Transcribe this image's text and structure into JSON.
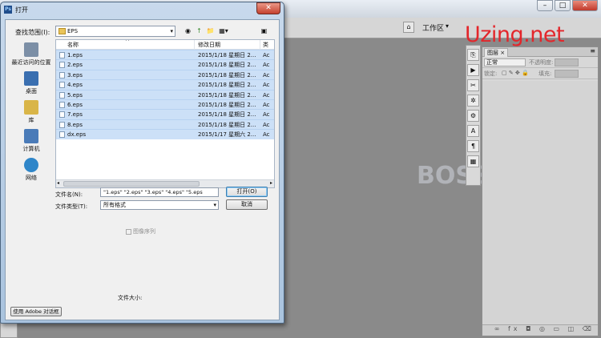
{
  "window_controls": {
    "minimize": "–",
    "maximize": "□",
    "close": "✕"
  },
  "options_bar": {
    "workspace_label": "工作区",
    "workspace_arrow": "▾"
  },
  "logo_text": "Uzing.net",
  "watermark_text": "BOSS 资源",
  "layers_panel": {
    "tab_label": "图层 ×",
    "menu_icon": "≡",
    "blend_mode": "正常",
    "opacity_label": "不透明度:",
    "lock_label": "锁定:",
    "fill_label": "填充:",
    "footer_icons": "∞ fx ◘ ◎ ▭ ◫ ⌫"
  },
  "tool_icons": [
    "⎘",
    "▶",
    "✂",
    "✲",
    "⚙",
    "A",
    "¶",
    "▦"
  ],
  "dialog": {
    "title": "打开",
    "close_label": "✕",
    "lookin_label": "查找范围(I):",
    "lookin_value": "EPS",
    "nav_icons": [
      "◉",
      "↑",
      "📁",
      "▦▾"
    ],
    "extra_icon": "▣",
    "places": [
      {
        "label": "最近访问的位置",
        "color": "#7c8fa6"
      },
      {
        "label": "桌面",
        "color": "#3a6fb0"
      },
      {
        "label": "库",
        "color": "#d9b548"
      },
      {
        "label": "计算机",
        "color": "#4a7bb8"
      },
      {
        "label": "网络",
        "color": "#2f86c9"
      }
    ],
    "columns": {
      "name": "名称",
      "date": "修改日期",
      "type": "类"
    },
    "sort_arrow": "^",
    "files": [
      {
        "name": "1.eps",
        "date": "2015/1/18 星期日 2...",
        "type": "Ac",
        "selected": true
      },
      {
        "name": "2.eps",
        "date": "2015/1/18 星期日 2...",
        "type": "Ac",
        "selected": true
      },
      {
        "name": "3.eps",
        "date": "2015/1/18 星期日 2...",
        "type": "Ac",
        "selected": true
      },
      {
        "name": "4.eps",
        "date": "2015/1/18 星期日 2...",
        "type": "Ac",
        "selected": true
      },
      {
        "name": "5.eps",
        "date": "2015/1/18 星期日 2...",
        "type": "Ac",
        "selected": true
      },
      {
        "name": "6.eps",
        "date": "2015/1/18 星期日 2...",
        "type": "Ac",
        "selected": true
      },
      {
        "name": "7.eps",
        "date": "2015/1/18 星期日 2...",
        "type": "Ac",
        "selected": true
      },
      {
        "name": "8.eps",
        "date": "2015/1/18 星期日 2...",
        "type": "Ac",
        "selected": true
      },
      {
        "name": "dx.eps",
        "date": "2015/1/17 星期六 2...",
        "type": "Ac",
        "selected": true
      }
    ],
    "scroll_left": "◂",
    "scroll_right": "▸",
    "filename_label": "文件名(N):",
    "filename_value": "\"1.eps\" \"2.eps\" \"3.eps\" \"4.eps\" \"5.eps",
    "filetype_label": "文件类型(T):",
    "filetype_value": "所有格式",
    "open_button": "打开(O)",
    "cancel_button": "取消",
    "image_sequence_label": "图像序列",
    "file_size_label": "文件大小:",
    "use_adobe_dialog": "使用 Adobe 对话框"
  }
}
